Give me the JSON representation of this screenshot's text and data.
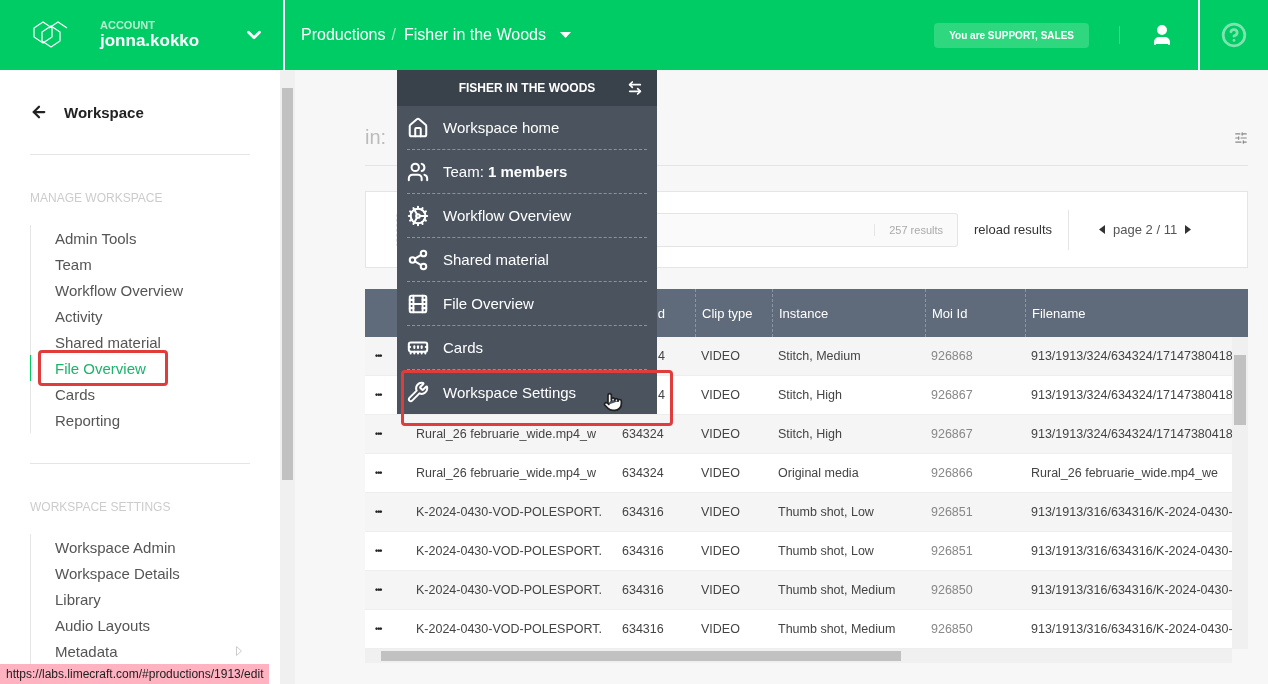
{
  "header": {
    "account_label": "ACCOUNT",
    "account_name": "jonna.kokko",
    "breadcrumb": [
      "Productions",
      "Fisher in the Woods"
    ],
    "separator": "/",
    "role_badge": "You are SUPPORT, SALES"
  },
  "sidebar": {
    "back_label": "Workspace",
    "sections": [
      {
        "title": "MANAGE WORKSPACE",
        "items": [
          {
            "label": "Admin Tools",
            "selected": false,
            "highlighted": false,
            "submenu": false
          },
          {
            "label": "Team",
            "selected": false,
            "highlighted": false,
            "submenu": false
          },
          {
            "label": "Workflow Overview",
            "selected": false,
            "highlighted": false,
            "submenu": false
          },
          {
            "label": "Activity",
            "selected": false,
            "highlighted": false,
            "submenu": false
          },
          {
            "label": "Shared material",
            "selected": false,
            "highlighted": false,
            "submenu": false
          },
          {
            "label": "File Overview",
            "selected": true,
            "highlighted": true,
            "submenu": false
          },
          {
            "label": "Cards",
            "selected": false,
            "highlighted": false,
            "submenu": false
          },
          {
            "label": "Reporting",
            "selected": false,
            "highlighted": false,
            "submenu": false
          }
        ]
      },
      {
        "title": "WORKSPACE SETTINGS",
        "items": [
          {
            "label": "Workspace Admin",
            "selected": false,
            "highlighted": false,
            "submenu": false
          },
          {
            "label": "Workspace Details",
            "selected": false,
            "highlighted": false,
            "submenu": false
          },
          {
            "label": "Library",
            "selected": false,
            "highlighted": false,
            "submenu": false
          },
          {
            "label": "Audio Layouts",
            "selected": false,
            "highlighted": false,
            "submenu": false
          },
          {
            "label": "Metadata",
            "selected": false,
            "highlighted": false,
            "submenu": true
          }
        ]
      }
    ]
  },
  "status_url": "https://labs.limecraft.com/#productions/1913/edit",
  "main": {
    "filter_label": "in:",
    "toolbar": {
      "results": "257 results",
      "reload": "reload results",
      "pager": "page 2 / 11"
    }
  },
  "table": {
    "columns": [
      {
        "label": "d",
        "cut": true
      },
      {
        "label": "Clip type",
        "cut": false
      },
      {
        "label": "Instance",
        "cut": false
      },
      {
        "label": "Moi Id",
        "cut": false
      },
      {
        "label": "Filename",
        "cut": false
      }
    ],
    "rows": [
      {
        "actions": "•••",
        "id": "4",
        "id_cut": true,
        "clip_type": "VIDEO",
        "instance": "Stitch, Medium",
        "moi_id": "926868",
        "filename": "913/1913/324/634324/17147380418"
      },
      {
        "actions": "•••",
        "id": "4",
        "id_cut": true,
        "clip_type": "VIDEO",
        "instance": "Stitch, High",
        "moi_id": "926867",
        "filename": "913/1913/324/634324/17147380418"
      },
      {
        "actions": "•••",
        "name": "Rural_26 februarie_wide.mp4_w",
        "id": "634324",
        "id_cut": false,
        "clip_type": "VIDEO",
        "instance": "Stitch, High",
        "moi_id": "926867",
        "filename": "913/1913/324/634324/17147380418"
      },
      {
        "actions": "•••",
        "name": "Rural_26 februarie_wide.mp4_w",
        "id": "634324",
        "id_cut": false,
        "clip_type": "VIDEO",
        "instance": "Original media",
        "moi_id": "926866",
        "filename": "Rural_26 februarie_wide.mp4_we"
      },
      {
        "actions": "•••",
        "name": "K-2024-0430-VOD-POLESPORT.",
        "id": "634316",
        "id_cut": false,
        "clip_type": "VIDEO",
        "instance": "Thumb shot, Low",
        "moi_id": "926851",
        "filename": "913/1913/316/634316/K-2024-0430-"
      },
      {
        "actions": "•••",
        "name": "K-2024-0430-VOD-POLESPORT.",
        "id": "634316",
        "id_cut": false,
        "clip_type": "VIDEO",
        "instance": "Thumb shot, Low",
        "moi_id": "926851",
        "filename": "913/1913/316/634316/K-2024-0430-"
      },
      {
        "actions": "•••",
        "name": "K-2024-0430-VOD-POLESPORT.",
        "id": "634316",
        "id_cut": false,
        "clip_type": "VIDEO",
        "instance": "Thumb shot, Medium",
        "moi_id": "926850",
        "filename": "913/1913/316/634316/K-2024-0430-"
      },
      {
        "actions": "•••",
        "name": "K-2024-0430-VOD-POLESPORT.",
        "id": "634316",
        "id_cut": false,
        "clip_type": "VIDEO",
        "instance": "Thumb shot, Medium",
        "moi_id": "926850",
        "filename": "913/1913/316/634316/K-2024-0430-"
      }
    ]
  },
  "menu": {
    "title": "FISHER IN THE WOODS",
    "items": [
      {
        "label": "Workspace home",
        "highlighted": false,
        "hovered": false
      },
      {
        "label": "Team: **1 members**",
        "highlighted": false,
        "hovered": false
      },
      {
        "label": "Workflow Overview",
        "highlighted": false,
        "hovered": false
      },
      {
        "label": "Shared material",
        "highlighted": false,
        "hovered": false
      },
      {
        "label": "File Overview",
        "highlighted": false,
        "hovered": false
      },
      {
        "label": "Cards",
        "highlighted": false,
        "hovered": false
      },
      {
        "label": "Workspace Settings",
        "highlighted": true,
        "hovered": true
      }
    ]
  }
}
